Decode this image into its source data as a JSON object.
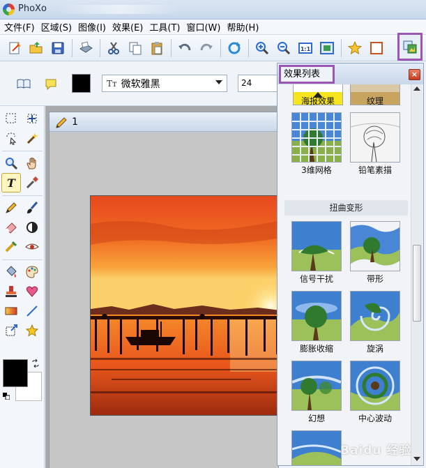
{
  "window": {
    "title": "PhoXo"
  },
  "menu": [
    "文件(F)",
    "区域(S)",
    "图像(I)",
    "效果(E)",
    "工具(T)",
    "窗口(W)",
    "帮助(H)"
  ],
  "textbar": {
    "font_name": "微软雅黑",
    "font_glyph": "Tт",
    "font_size": "24",
    "color": "#000000"
  },
  "document": {
    "title": "1"
  },
  "effect_panel": {
    "title": "效果列表",
    "close": "×",
    "category": "扭曲变形",
    "effects": [
      "海报效果",
      "纹理",
      "3维网格",
      "铅笔素描",
      "信号干扰",
      "带形",
      "膨胀收缩",
      "旋涡",
      "幻想",
      "中心波动"
    ]
  },
  "colors": {
    "highlight": "#9b56b4",
    "foreground": "#000000",
    "background": "#ffffff"
  },
  "watermark": "Baidu 经验"
}
